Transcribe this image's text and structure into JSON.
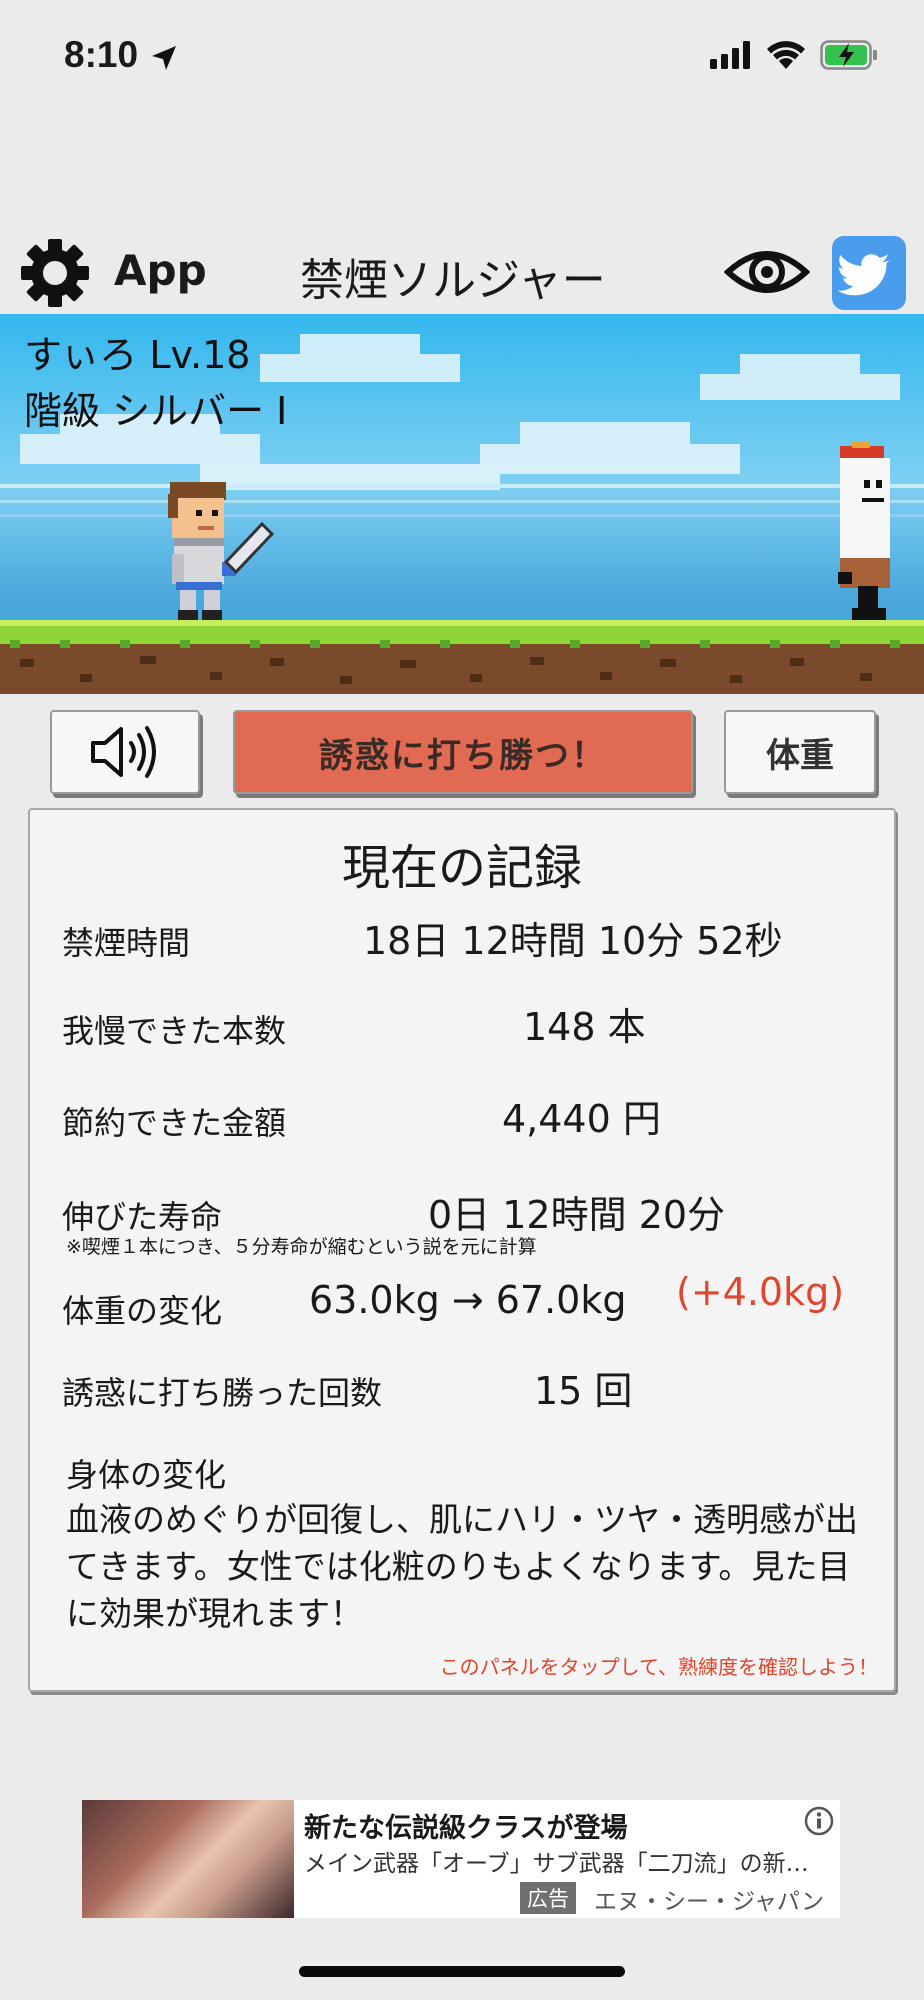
{
  "status_bar": {
    "time": "8:10"
  },
  "nav": {
    "app_label": "App",
    "title": "禁煙ソルジャー",
    "icons": [
      "gear-icon",
      "eye-icon",
      "twitter-icon"
    ],
    "twitter_color": "#4a9ded"
  },
  "scene": {
    "player_name": "すぃろ Lv.18",
    "player_rank": "階級 シルバー I"
  },
  "actions": {
    "sound_icon": "speaker-icon",
    "win_label": "誘惑に打ち勝つ！",
    "weight_label": "体重",
    "win_color": "#e06a52"
  },
  "record": {
    "title": "現在の記録",
    "rows": [
      {
        "label": "禁煙時間",
        "value": "18日 12時間 10分 52秒"
      },
      {
        "label": "我慢できた本数",
        "value": "148 本"
      },
      {
        "label": "節約できた金額",
        "value": "4,440 円"
      },
      {
        "label": "伸びた寿命",
        "value": "0日 12時間 20分"
      },
      {
        "label": "体重の変化",
        "value": "63.0kg → 67.0kg"
      },
      {
        "label": "誘惑に打ち勝った回数",
        "value": "15 回"
      }
    ],
    "lifespan_note": "※喫煙１本につき、５分寿命が縮むという説を元に計算",
    "weight_diff": "(+4.0kg)",
    "body_title": "身体の変化",
    "body_text": "血液のめぐりが回復し、肌にハリ・ツヤ・透明感が出てきます。女性では化粧のりもよくなります。見た目に効果が現れます！",
    "hint": "このパネルをタップして、熟練度を確認しよう！",
    "accent_red": "#e0452d"
  },
  "ad": {
    "headline": "新たな伝説級クラスが登場",
    "body": "メイン武器「オーブ」サブ武器「二刀流」の新職業が登場",
    "badge": "広告",
    "advertiser": "エヌ・シー・ジャパン"
  }
}
